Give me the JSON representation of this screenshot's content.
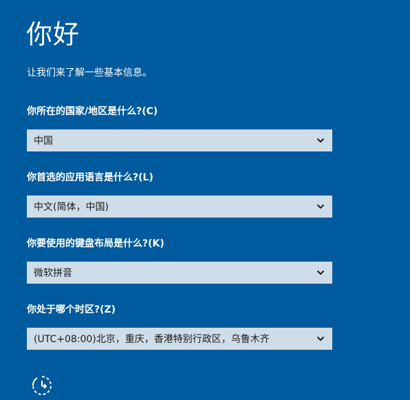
{
  "header": {
    "title": "你好",
    "subtitle": "让我们来了解一些基本信息。"
  },
  "fields": [
    {
      "label": "你所在的国家/地区是什么?(C)",
      "value": "中国"
    },
    {
      "label": "你首选的应用语言是什么?(L)",
      "value": "中文(简体，中国)"
    },
    {
      "label": "你要使用的键盘布局是什么?(K)",
      "value": "微软拼音"
    },
    {
      "label": "你处于哪个时区?(Z)",
      "value": "(UTC+08:00)北京，重庆，香港特别行政区，乌鲁木齐"
    }
  ],
  "icons": {
    "dropdown": "chevron-down-icon",
    "accessibility": "ease-of-access-icon"
  },
  "colors": {
    "background": "#005a9e",
    "field_background": "#cfdde9",
    "text": "#ffffff",
    "field_text": "#1b1b1b"
  }
}
